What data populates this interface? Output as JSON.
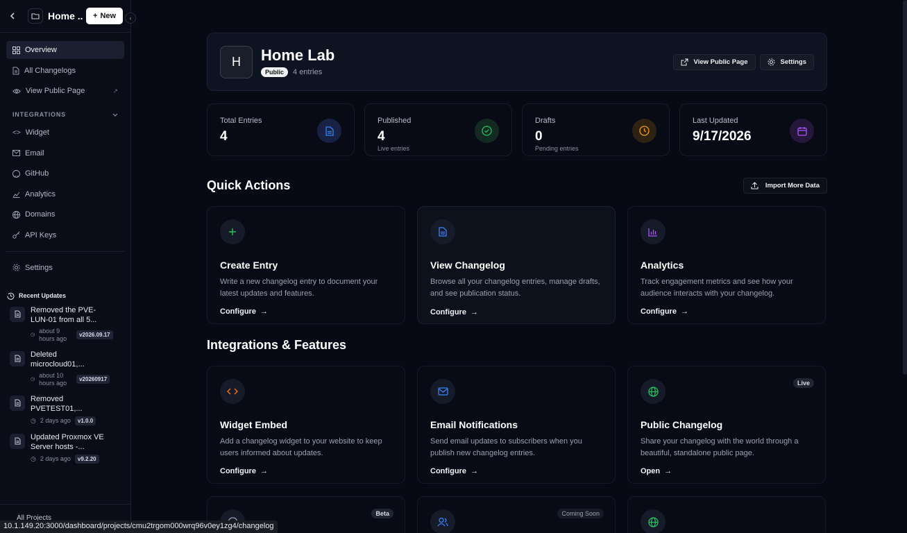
{
  "sidebar": {
    "project_title": "Home ...",
    "new_label": "New",
    "nav": [
      {
        "label": "Overview"
      },
      {
        "label": "All Changelogs"
      },
      {
        "label": "View Public Page"
      }
    ],
    "integrations_label": "INTEGRATIONS",
    "integrations": [
      {
        "label": "Widget"
      },
      {
        "label": "Email"
      },
      {
        "label": "GitHub"
      },
      {
        "label": "Analytics"
      },
      {
        "label": "Domains"
      },
      {
        "label": "API Keys"
      }
    ],
    "settings_label": "Settings",
    "recent_title": "Recent Updates",
    "recent": [
      {
        "title": "Removed the PVE-LUN-01 from all 5...",
        "time": "about 9 hours ago",
        "version": "v2026.09.17"
      },
      {
        "title": "Deleted microcloud01,...",
        "time": "about 10 hours ago",
        "version": "v20260917"
      },
      {
        "title": "Removed PVETEST01,...",
        "time": "2 days ago",
        "version": "v1.0.0"
      },
      {
        "title": "Updated Proxmox VE Server hosts -...",
        "time": "2 days ago",
        "version": "v9.2.20"
      }
    ],
    "footer_label": "All Projects"
  },
  "status_url": "10.1.149.20:3000/dashboard/projects/cmu2trgom000wrq96v0ey1zg4/changelog",
  "hero": {
    "avatar_letter": "H",
    "title": "Home Lab",
    "badge": "Public",
    "entries": "4 entries",
    "view_public_label": "View Public Page",
    "settings_label": "Settings"
  },
  "stats": [
    {
      "label": "Total Entries",
      "value": "4",
      "sub": "",
      "color": "#3b82f6"
    },
    {
      "label": "Published",
      "value": "4",
      "sub": "Live entries",
      "color": "#22c55e"
    },
    {
      "label": "Drafts",
      "value": "0",
      "sub": "Pending entries",
      "color": "#f59e0b"
    },
    {
      "label": "Last Updated",
      "value": "9/17/2026",
      "sub": "",
      "color": "#a855f7"
    }
  ],
  "quick_actions": {
    "title": "Quick Actions",
    "import_label": "Import More Data",
    "cards": [
      {
        "title": "Create Entry",
        "desc": "Write a new changelog entry to document your latest updates and features.",
        "link": "Configure",
        "icon": "plus-icon",
        "color": "#22c55e"
      },
      {
        "title": "View Changelog",
        "desc": "Browse all your changelog entries, manage drafts, and see publication status.",
        "link": "Configure",
        "icon": "document-icon",
        "color": "#3b82f6"
      },
      {
        "title": "Analytics",
        "desc": "Track engagement metrics and see how your audience interacts with your changelog.",
        "link": "Configure",
        "icon": "bar-chart-icon",
        "color": "#a855f7"
      }
    ]
  },
  "integrations": {
    "title": "Integrations & Features",
    "cards": [
      {
        "title": "Widget Embed",
        "desc": "Add a changelog widget to your website to keep users informed about updates.",
        "link": "Configure",
        "badge": "",
        "icon": "code-icon",
        "color": "#f97316"
      },
      {
        "title": "Email Notifications",
        "desc": "Send email updates to subscribers when you publish new changelog entries.",
        "link": "Configure",
        "badge": "",
        "icon": "mail-icon",
        "color": "#3b82f6"
      },
      {
        "title": "Public Changelog",
        "desc": "Share your changelog with the world through a beautiful, standalone public page.",
        "link": "Open",
        "badge": "Live",
        "icon": "globe-icon",
        "color": "#22c55e"
      }
    ],
    "row2_badges": [
      "Beta",
      "Coming Soon",
      ""
    ]
  }
}
